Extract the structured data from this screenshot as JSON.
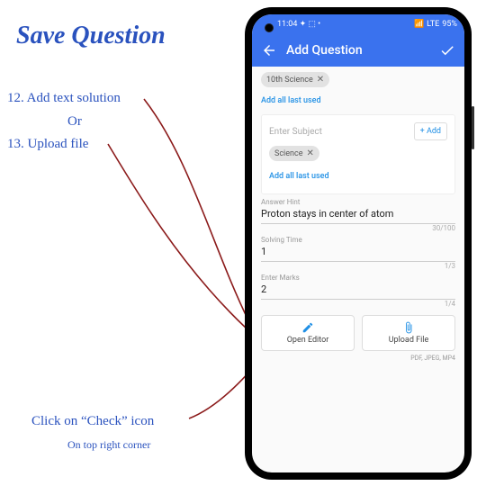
{
  "annotations": {
    "title": "Save Question",
    "step12": "12. Add text solution",
    "or": "Or",
    "step13": "13. Upload file",
    "bottom": "Click on “Check” icon",
    "sub": "On top right corner"
  },
  "status": {
    "time": "11:04",
    "battery": "95%"
  },
  "appbar": {
    "title": "Add Question"
  },
  "chips": {
    "class": "10th Science",
    "subject": "Science"
  },
  "links": {
    "add_all": "Add all last used"
  },
  "subject": {
    "placeholder": "Enter Subject",
    "add_btn": "+ Add"
  },
  "hint": {
    "label": "Answer Hint",
    "value": "Proton stays in center of atom",
    "counter": "30/100"
  },
  "time": {
    "label": "Solving Time",
    "value": "1",
    "counter": "1/3"
  },
  "marks": {
    "label": "Enter Marks",
    "value": "2",
    "counter": "1/4"
  },
  "actions": {
    "editor": "Open Editor",
    "upload": "Upload File",
    "upload_hint": "PDF, JPEG, MP4"
  }
}
